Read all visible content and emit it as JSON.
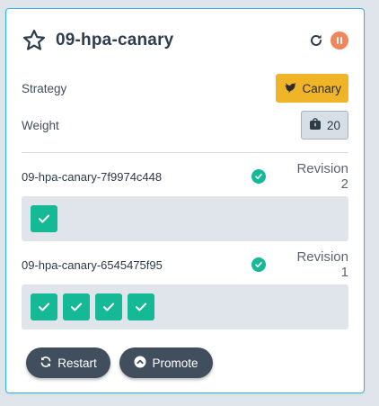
{
  "header": {
    "title": "09-hpa-canary",
    "favorite_icon": "star-icon",
    "refresh_icon": "refresh-icon",
    "pause_icon": "pause-icon",
    "pause_color": "#f0865c"
  },
  "details": {
    "strategy_label": "Strategy",
    "strategy_value": "Canary",
    "strategy_icon": "bird-icon",
    "strategy_color": "#f0b429",
    "weight_label": "Weight",
    "weight_value": "20",
    "weight_icon": "weight-icon"
  },
  "revisions": [
    {
      "replicaset": "09-hpa-canary-7f9974c448",
      "status_icon": "check-circle-icon",
      "label": "Revision 2",
      "pods": 1
    },
    {
      "replicaset": "09-hpa-canary-6545475f95",
      "status_icon": "check-circle-icon",
      "label": "Revision 1",
      "pods": 4
    }
  ],
  "actions": {
    "restart_label": "Restart",
    "restart_icon": "refresh-icon",
    "promote_label": "Promote",
    "promote_icon": "chevron-up-circle-icon"
  },
  "colors": {
    "healthy": "#16b995",
    "accent_border": "#32b3d8",
    "button_bg": "#414e5d"
  }
}
